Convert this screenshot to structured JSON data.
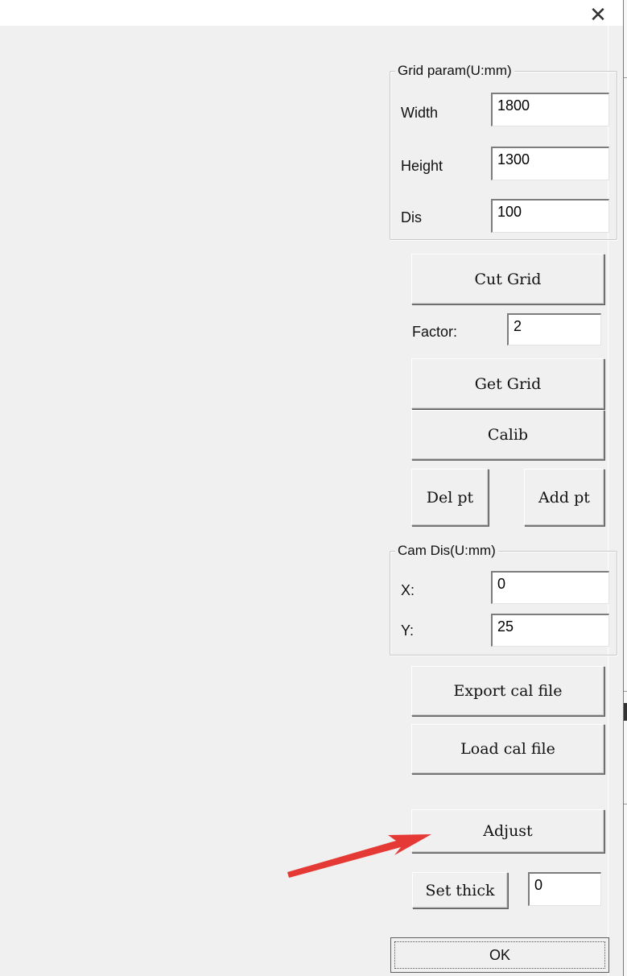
{
  "window": {
    "close_glyph": "✕"
  },
  "grid_param": {
    "title": "Grid param(U:mm)",
    "width_label": "Width",
    "width_value": "1800",
    "height_label": "Height",
    "height_value": "1300",
    "dis_label": "Dis",
    "dis_value": "100"
  },
  "cut_grid_label": "Cut Grid",
  "factor": {
    "label": "Factor:",
    "value": "2"
  },
  "get_grid_label": "Get Grid",
  "calib_label": "Calib",
  "del_pt_label": "Del pt",
  "add_pt_label": "Add pt",
  "cam_dis": {
    "title": "Cam Dis(U:mm)",
    "x_label": "X:",
    "x_value": "0",
    "y_label": "Y:",
    "y_value": "25"
  },
  "export_label": "Export cal file",
  "load_label": "Load cal file",
  "adjust_label": "Adjust",
  "set_thick": {
    "label": "Set thick",
    "value": "0"
  },
  "ok_label": "OK",
  "annotation": {
    "arrow_color": "#e53935",
    "arrow_icon": "red-arrow-icon"
  }
}
